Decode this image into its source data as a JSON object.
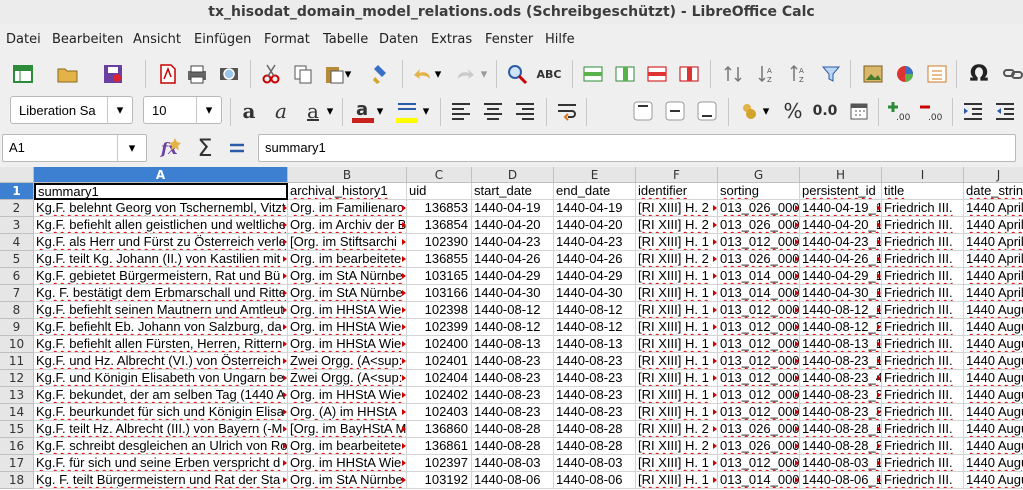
{
  "window": {
    "title": "tx_hisodat_domain_model_relations.ods (Schreibgeschützt) - LibreOffice Calc"
  },
  "menu": [
    "Datei",
    "Bearbeiten",
    "Ansicht",
    "Einfügen",
    "Format",
    "Tabelle",
    "Daten",
    "Extras",
    "Fenster",
    "Hilfe"
  ],
  "format_toolbar": {
    "font_name": "Liberation Sa",
    "font_size": "10",
    "percent": "%",
    "decimal": "0.0"
  },
  "formula_bar": {
    "name_box": "A1",
    "content": "summary1"
  },
  "columns": [
    "A",
    "B",
    "C",
    "D",
    "E",
    "F",
    "G",
    "H",
    "I",
    "J"
  ],
  "rows": [
    {
      "n": "1",
      "cells": [
        "summary1",
        "archival_history1",
        "uid",
        "start_date",
        "end_date",
        "identifier",
        "sorting",
        "persistent_id",
        "title",
        "date_strin"
      ]
    },
    {
      "n": "2",
      "cells": [
        "Kg.F. belehnt Georg von Tschernembl, Vitzt",
        "Org. im Familienarc",
        "136853",
        "1440-04-19",
        "1440-04-19",
        "[RI XIII] H. 2",
        "013_026_000",
        "1440-04-19_1",
        "Friedrich III.",
        "1440 April"
      ]
    },
    {
      "n": "3",
      "cells": [
        "Kg.F. befiehlt allen geistlichen und weltliche",
        "Org. im Archiv der B",
        "136854",
        "1440-04-20",
        "1440-04-20",
        "[RI XIII] H. 2",
        "013_026_000",
        "1440-04-20_1",
        "Friedrich III.",
        "1440 April"
      ]
    },
    {
      "n": "4",
      "cells": [
        "Kg.F. als Herr und Fürst zu Österreich verle",
        "[Org. im Stiftsarchi",
        "102390",
        "1440-04-23",
        "1440-04-23",
        "[RI XIII] H. 1",
        "013_012_000",
        "1440-04-23_1",
        "Friedrich III.",
        "1440 April"
      ]
    },
    {
      "n": "5",
      "cells": [
        "Kg.F. teilt Kg. Johann (II.) von Kastilien mit",
        "Org. im bearbeitete",
        "136855",
        "1440-04-26",
        "1440-04-26",
        "[RI XIII] H. 2",
        "013_026_000",
        "1440-04-26_1",
        "Friedrich III.",
        "1440 April"
      ]
    },
    {
      "n": "6",
      "cells": [
        "Kg.F. gebietet Bürgermeistern, Rat und Bü",
        "Org. im StA Nürnbe",
        "103165",
        "1440-04-29",
        "1440-04-29",
        "[RI XIII] H. 1",
        "013_014_000",
        "1440-04-29_1",
        "Friedrich III.",
        "1440 April"
      ]
    },
    {
      "n": "7",
      "cells": [
        "Kg. F. bestätigt dem Erbmarschall und Ritte",
        "Org. im StA Nürnbe",
        "103166",
        "1440-04-30",
        "1440-04-30",
        "[RI XIII] H. 1",
        "013_014_000",
        "1440-04-30_1",
        "Friedrich III.",
        "1440 April"
      ]
    },
    {
      "n": "8",
      "cells": [
        "Kg.F. befiehlt seinen Mautnern und Amtleut",
        "Org. im HHStA Wie",
        "102398",
        "1440-08-12",
        "1440-08-12",
        "[RI XIII] H. 1",
        "013_012_000",
        "1440-08-12_1",
        "Friedrich III.",
        "1440 Augu"
      ]
    },
    {
      "n": "9",
      "cells": [
        "Kg.F. befiehlt Eb. Johann von Salzburg, da",
        "Org. im HHStA Wie",
        "102399",
        "1440-08-12",
        "1440-08-12",
        "[RI XIII] H. 1",
        "013_012_000",
        "1440-08-12_2",
        "Friedrich III.",
        "1440 Augu"
      ]
    },
    {
      "n": "10",
      "cells": [
        "Kg.F. befiehlt allen Fürsten, Herren, Rittern",
        "Org. im HHStA Wie",
        "102400",
        "1440-08-13",
        "1440-08-13",
        "[RI XIII] H. 1",
        "013_012_000",
        "1440-08-13_1",
        "Friedrich III.",
        "1440 Augu"
      ]
    },
    {
      "n": "11",
      "cells": [
        "Kg.F. und Hz. Albrecht (VI.) von Österreich",
        "Zwei Orgg. (A<sup:",
        "102401",
        "1440-08-23",
        "1440-08-23",
        "[RI XIII] H. 1",
        "013_012_000",
        "1440-08-23_1",
        "Friedrich III.",
        "1440 Augu"
      ]
    },
    {
      "n": "12",
      "cells": [
        "Kg.F. und Königin Elisabeth von Ungarn be",
        "Zwei Orgg. (A<sup:",
        "102404",
        "1440-08-23",
        "1440-08-23",
        "[RI XIII] H. 1",
        "013_012_000",
        "1440-08-23_4",
        "Friedrich III.",
        "1440 Augu"
      ]
    },
    {
      "n": "13",
      "cells": [
        "Kg.F. bekundet, der am selben Tag (1440 A",
        "Org. im HHStA Wie",
        "102402",
        "1440-08-23",
        "1440-08-23",
        "[RI XIII] H. 1",
        "013_012_000",
        "1440-08-23_2",
        "Friedrich III.",
        "1440 Augu"
      ]
    },
    {
      "n": "14",
      "cells": [
        "Kg.F. beurkundet für sich und Königin Elisa",
        "Org. (A) im HHStA",
        "102403",
        "1440-08-23",
        "1440-08-23",
        "[RI XIII] H. 1",
        "013_012_000",
        "1440-08-23_3",
        "Friedrich III.",
        "1440 Augu"
      ]
    },
    {
      "n": "15",
      "cells": [
        "Kg.F. teilt Hz. Albrecht (III.) von Bayern (-M",
        "[Org. im BayHStA M",
        "136860",
        "1440-08-28",
        "1440-08-28",
        "[RI XIII] H. 2",
        "013_026_000",
        "1440-08-28_1",
        "Friedrich III.",
        "1440 Augu"
      ]
    },
    {
      "n": "16",
      "cells": [
        "Kg.F. schreibt desgleichen an Ulrich von Ro",
        "Org. im bearbeitete",
        "136861",
        "1440-08-28",
        "1440-08-28",
        "[RI XIII] H. 2",
        "013_026_000",
        "1440-08-28_2",
        "Friedrich III.",
        "1440 Augu"
      ]
    },
    {
      "n": "17",
      "cells": [
        "Kg.F. für sich und seine Erben verspricht d",
        "Org. im HHStA Wie",
        "102397",
        "1440-08-03",
        "1440-08-03",
        "[RI XIII] H. 1",
        "013_012_000",
        "1440-08-03_1",
        "Friedrich III.",
        "1440 Augu"
      ]
    },
    {
      "n": "18",
      "cells": [
        "Kg. F. teilt Bürgermeistern und Rat der Sta",
        "Org. im StA Nürnbe",
        "103192",
        "1440-08-06",
        "1440-08-06",
        "[RI XIII] H. 1",
        "013_014_000",
        "1440-08-06_1",
        "Friedrich III.",
        "1440 Augu"
      ]
    }
  ]
}
